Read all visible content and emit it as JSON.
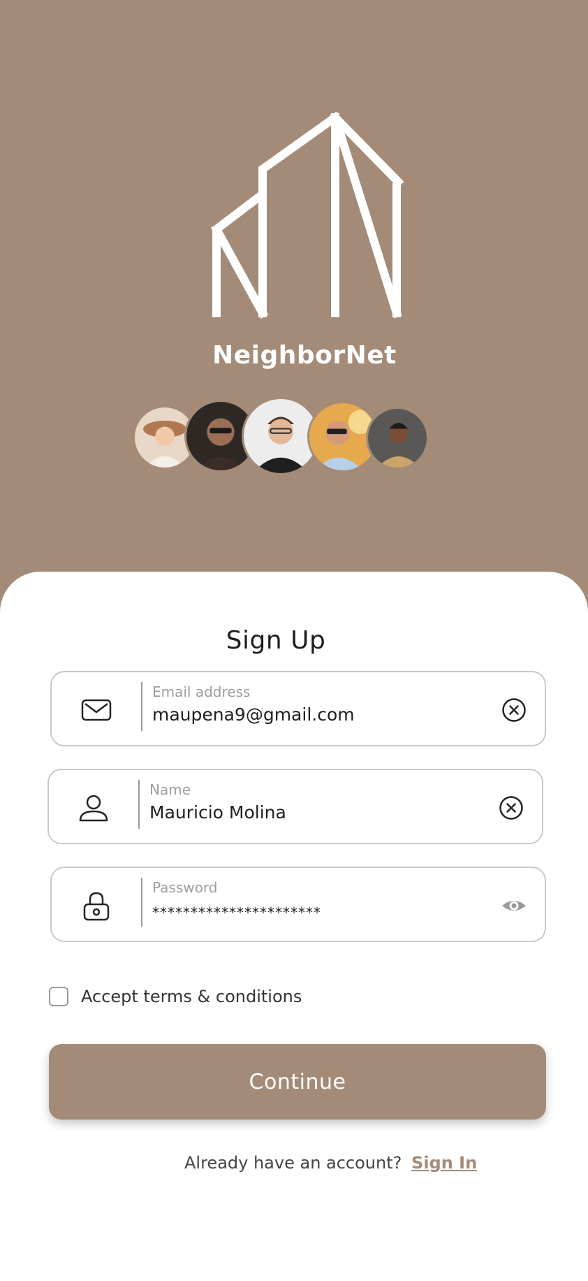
{
  "app": {
    "name": "NeighborNet"
  },
  "branding": {
    "logo_icon": "building-outline-logo",
    "accent_color": "#a38b78"
  },
  "avatars": [
    {
      "name": "avatar-1"
    },
    {
      "name": "avatar-2"
    },
    {
      "name": "avatar-3"
    },
    {
      "name": "avatar-4"
    },
    {
      "name": "avatar-5"
    }
  ],
  "form": {
    "title": "Sign Up",
    "email": {
      "label": "Email address",
      "value": "maupena9@gmail.com",
      "icon": "mail-icon",
      "action_icon": "clear-icon"
    },
    "name": {
      "label": "Name",
      "value": "Mauricio Molina",
      "icon": "user-icon",
      "action_icon": "clear-icon"
    },
    "password": {
      "label": "Password",
      "value": "**********************",
      "icon": "lock-icon",
      "action_icon": "eye-icon"
    },
    "terms_label": "Accept terms & conditions",
    "terms_checked": false,
    "continue_label": "Continue",
    "signin_prompt": "Already have an account?",
    "signin_link": "Sign In"
  }
}
